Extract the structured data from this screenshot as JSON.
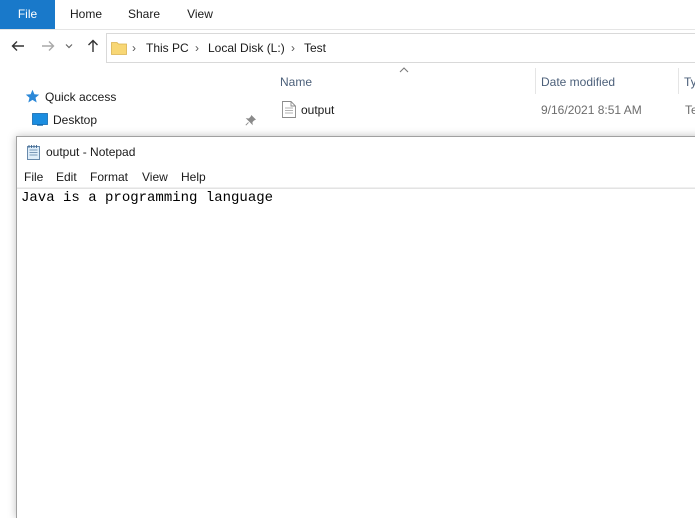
{
  "ribbon": {
    "tabs": [
      "File",
      "Home",
      "Share",
      "View"
    ]
  },
  "nav": {
    "breadcrumb": [
      "This PC",
      "Local Disk (L:)",
      "Test"
    ],
    "separator": "›"
  },
  "sidebar": {
    "items": [
      {
        "label": "Quick access",
        "icon": "star-icon"
      },
      {
        "label": "Desktop",
        "icon": "desktop-icon",
        "pinned": true
      }
    ]
  },
  "filelist": {
    "columns": [
      "Name",
      "Date modified",
      "Ty"
    ],
    "sort_column": "Name",
    "rows": [
      {
        "name": "output",
        "date": "9/16/2021 8:51 AM",
        "type": "Te"
      }
    ]
  },
  "notepad": {
    "title": "output - Notepad",
    "menu": [
      "File",
      "Edit",
      "Format",
      "View",
      "Help"
    ],
    "content": "Java is a programming language"
  },
  "colors": {
    "accent": "#1979ca",
    "folder": "#f8d775",
    "header_text": "#4c607a"
  }
}
